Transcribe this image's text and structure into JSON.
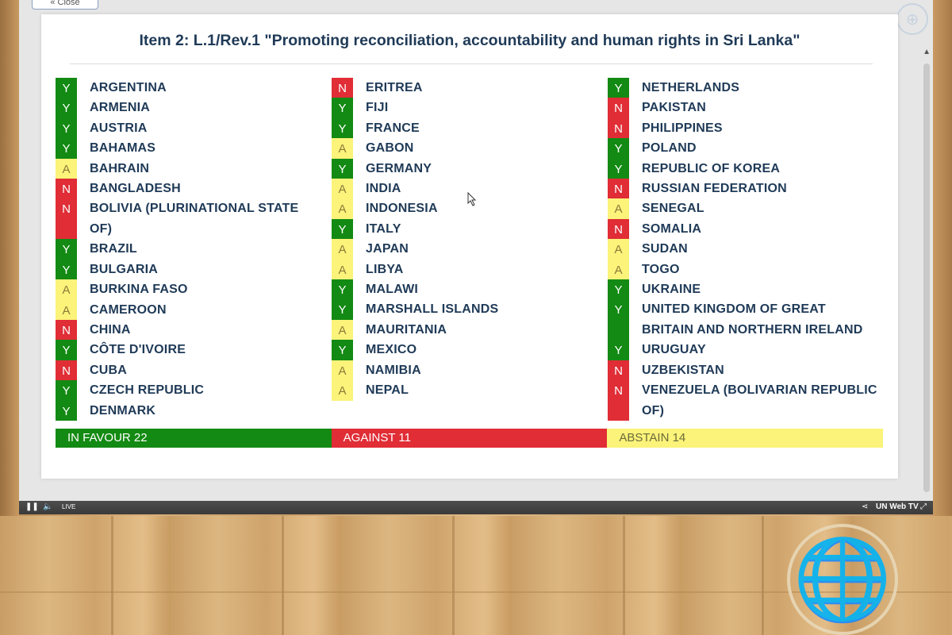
{
  "header": {
    "back_label": "Close"
  },
  "title": "Item 2: L.1/Rev.1 \"Promoting reconciliation, accountability and human rights in Sri Lanka\"",
  "columns": [
    [
      {
        "vote": "Y",
        "name": "ARGENTINA"
      },
      {
        "vote": "Y",
        "name": "ARMENIA"
      },
      {
        "vote": "Y",
        "name": "AUSTRIA"
      },
      {
        "vote": "Y",
        "name": "BAHAMAS"
      },
      {
        "vote": "A",
        "name": "BAHRAIN"
      },
      {
        "vote": "N",
        "name": "BANGLADESH"
      },
      {
        "vote": "N",
        "name": "BOLIVIA (PLURINATIONAL STATE OF)"
      },
      {
        "vote": "Y",
        "name": "BRAZIL"
      },
      {
        "vote": "Y",
        "name": "BULGARIA"
      },
      {
        "vote": "A",
        "name": "BURKINA FASO"
      },
      {
        "vote": "A",
        "name": "CAMEROON"
      },
      {
        "vote": "N",
        "name": "CHINA"
      },
      {
        "vote": "Y",
        "name": "CÔTE D'IVOIRE"
      },
      {
        "vote": "N",
        "name": "CUBA"
      },
      {
        "vote": "Y",
        "name": "CZECH REPUBLIC"
      },
      {
        "vote": "Y",
        "name": "DENMARK"
      }
    ],
    [
      {
        "vote": "N",
        "name": "ERITREA"
      },
      {
        "vote": "Y",
        "name": "FIJI"
      },
      {
        "vote": "Y",
        "name": "FRANCE"
      },
      {
        "vote": "A",
        "name": "GABON"
      },
      {
        "vote": "Y",
        "name": "GERMANY"
      },
      {
        "vote": "A",
        "name": "INDIA"
      },
      {
        "vote": "A",
        "name": "INDONESIA"
      },
      {
        "vote": "Y",
        "name": "ITALY"
      },
      {
        "vote": "A",
        "name": "JAPAN"
      },
      {
        "vote": "A",
        "name": "LIBYA"
      },
      {
        "vote": "Y",
        "name": "MALAWI"
      },
      {
        "vote": "Y",
        "name": "MARSHALL ISLANDS"
      },
      {
        "vote": "A",
        "name": "MAURITANIA"
      },
      {
        "vote": "Y",
        "name": "MEXICO"
      },
      {
        "vote": "A",
        "name": "NAMIBIA"
      },
      {
        "vote": "A",
        "name": "NEPAL"
      }
    ],
    [
      {
        "vote": "Y",
        "name": "NETHERLANDS"
      },
      {
        "vote": "N",
        "name": "PAKISTAN"
      },
      {
        "vote": "N",
        "name": "PHILIPPINES"
      },
      {
        "vote": "Y",
        "name": "POLAND"
      },
      {
        "vote": "Y",
        "name": "REPUBLIC OF KOREA"
      },
      {
        "vote": "N",
        "name": "RUSSIAN FEDERATION"
      },
      {
        "vote": "A",
        "name": "SENEGAL"
      },
      {
        "vote": "N",
        "name": "SOMALIA"
      },
      {
        "vote": "A",
        "name": "SUDAN"
      },
      {
        "vote": "A",
        "name": "TOGO"
      },
      {
        "vote": "Y",
        "name": "UKRAINE"
      },
      {
        "vote": "Y",
        "name": "UNITED KINGDOM OF GREAT BRITAIN AND NORTHERN IRELAND"
      },
      {
        "vote": "Y",
        "name": "URUGUAY"
      },
      {
        "vote": "N",
        "name": "UZBEKISTAN"
      },
      {
        "vote": "N",
        "name": "VENEZUELA (BOLIVARIAN REPUBLIC OF)"
      }
    ]
  ],
  "totals": {
    "favour": "IN FAVOUR 22",
    "against": "AGAINST 11",
    "abstain": "ABSTAIN 14"
  },
  "colors": {
    "yes": "#138a13",
    "no": "#e02d36",
    "abstain": "#fbf37a",
    "title": "#1f3a57"
  },
  "controls": {
    "live_label": "LIVE",
    "brand": "UN Web TV",
    "icons": [
      "pause-icon",
      "volume-icon",
      "share-icon",
      "fullscreen-icon"
    ]
  }
}
